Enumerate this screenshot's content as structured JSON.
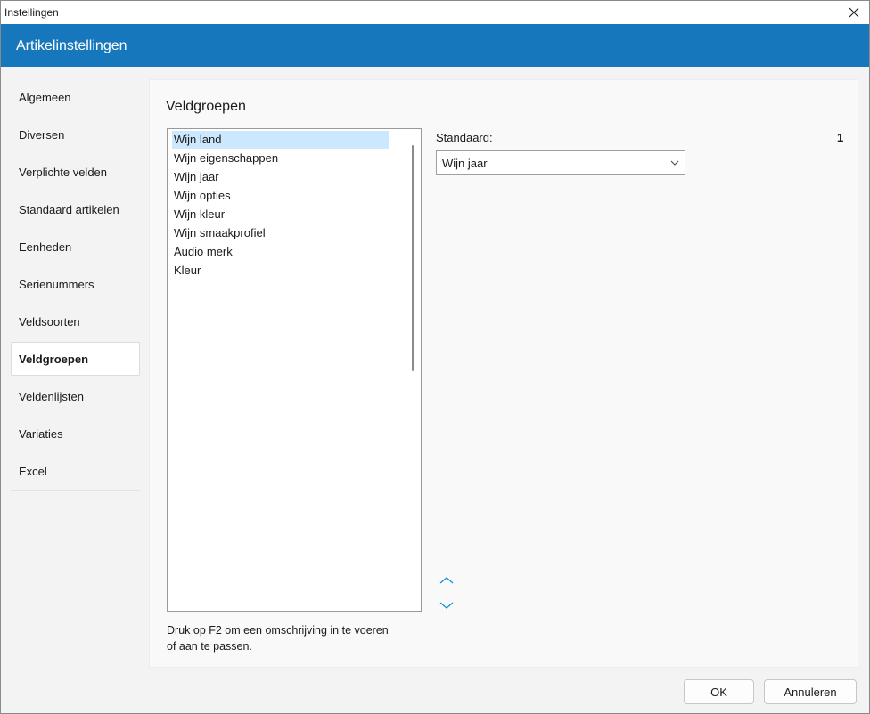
{
  "window": {
    "title": "Instellingen"
  },
  "header": {
    "title": "Artikelinstellingen"
  },
  "sidebar": {
    "items": [
      {
        "label": "Algemeen"
      },
      {
        "label": "Diversen"
      },
      {
        "label": "Verplichte velden"
      },
      {
        "label": "Standaard artikelen"
      },
      {
        "label": "Eenheden"
      },
      {
        "label": "Serienummers"
      },
      {
        "label": "Veldsoorten"
      },
      {
        "label": "Veldgroepen",
        "active": true
      },
      {
        "label": "Veldenlijsten"
      },
      {
        "label": "Variaties"
      },
      {
        "label": "Excel"
      }
    ]
  },
  "main": {
    "title": "Veldgroepen",
    "list": {
      "items": [
        {
          "label": "Wijn land",
          "selected": true
        },
        {
          "label": "Wijn eigenschappen"
        },
        {
          "label": "Wijn jaar"
        },
        {
          "label": "Wijn opties"
        },
        {
          "label": "Wijn kleur"
        },
        {
          "label": "Wijn smaakprofiel"
        },
        {
          "label": "Audio merk"
        },
        {
          "label": "Kleur"
        }
      ]
    },
    "hint": "Druk op F2 om een omschrijving in te voeren of aan te passen.",
    "standaard": {
      "label": "Standaard:",
      "count": "1",
      "selected_value": "Wijn jaar"
    }
  },
  "buttons": {
    "ok": "OK",
    "cancel": "Annuleren"
  },
  "colors": {
    "accent": "#1777bd",
    "selection": "#cce8ff",
    "arrow": "#1b8fd9"
  },
  "icons": {
    "close": "close-icon",
    "dropdown": "chevron-down-icon",
    "up": "chevron-up-icon",
    "down": "chevron-down-icon"
  }
}
